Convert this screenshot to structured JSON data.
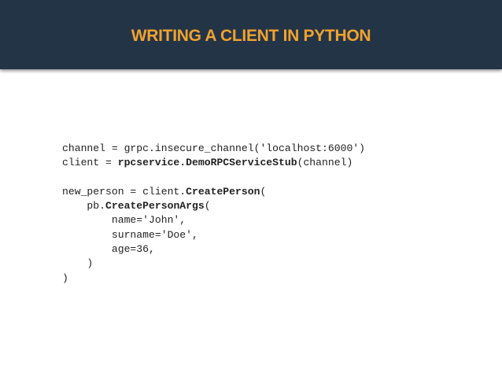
{
  "slide": {
    "title": "WRITING A CLIENT IN PYTHON"
  },
  "code": {
    "line1": "channel = grpc.insecure_channel('localhost:6000')",
    "line2_pre": "client = ",
    "line2_bold": "rpcservice.DemoRPCServiceStub",
    "line2_post": "(channel)",
    "line3": "",
    "line4_pre": "new_person = client.",
    "line4_bold": "CreatePerson",
    "line4_post": "(",
    "line5_pre": "    pb.",
    "line5_bold": "CreatePersonArgs",
    "line5_post": "(",
    "line6": "        name='John',",
    "line7": "        surname='Doe',",
    "line8": "        age=36,",
    "line9": "    )",
    "line10": ")"
  },
  "colors": {
    "header_background": "#243447",
    "title_text": "#f0a32e",
    "code_text": "#222222"
  }
}
